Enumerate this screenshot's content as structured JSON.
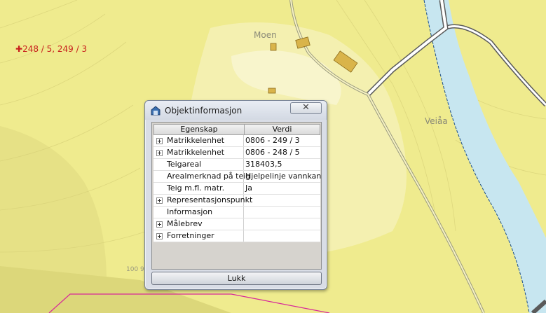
{
  "map": {
    "parcel_label": "248 / 5, 249 / 3",
    "place_moen": "Moen",
    "place_veiaa": "Veiåa",
    "contour_label": "100 9"
  },
  "dialog": {
    "title": "Objektinformasjon",
    "close_glyph": "✕",
    "columns": [
      "Egenskap",
      "Verdi"
    ],
    "rows": [
      {
        "property": "Matrikkelenhet",
        "value": "0806 - 249 / 3",
        "expandable": true
      },
      {
        "property": "Matrikkelenhet",
        "value": "0806 - 248 / 5",
        "expandable": true
      },
      {
        "property": "Teigareal",
        "value": "318403,5",
        "expandable": false
      },
      {
        "property": "Arealmerknad på teig",
        "value": "Hjelpelinje vannkan...",
        "expandable": false
      },
      {
        "property": "Teig m.fl. matr.",
        "value": "Ja",
        "expandable": false
      },
      {
        "property": "Representasjonspunkt",
        "value": "",
        "expandable": true
      },
      {
        "property": "Informasjon",
        "value": "",
        "expandable": false
      },
      {
        "property": "Målebrev",
        "value": "",
        "expandable": true
      },
      {
        "property": "Forretninger",
        "value": "",
        "expandable": true
      }
    ],
    "close_button": "Lukk"
  },
  "colors": {
    "map_base": "#efeb8e",
    "map_light": "#f5f1b4",
    "river": "#c7e6f0",
    "parcel_text": "#c8201e",
    "building": "#d9b44a",
    "road_edge": "#4a4a4a"
  }
}
